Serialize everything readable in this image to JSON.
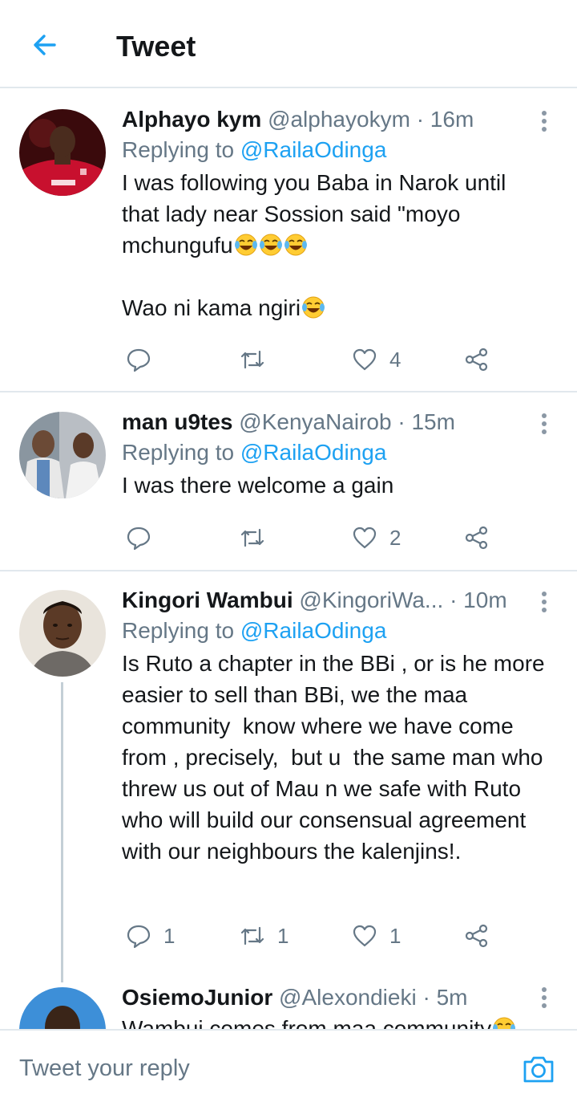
{
  "header": {
    "title": "Tweet",
    "back_icon": "arrow-left-icon"
  },
  "colors": {
    "accent": "#1da1f2",
    "text": "#14171a",
    "secondary": "#657786",
    "divider": "#e1e8ed"
  },
  "tweets": [
    {
      "display_name": "Alphayo kym",
      "handle": "@alphayokym",
      "dot": "·",
      "time": "16m",
      "replying_prefix": "Replying to ",
      "replying_to": "@RailaOdinga",
      "text_line1": "I was following you Baba in Narok until that lady near Sossion said \"moyo mchungufu",
      "text_line2": "Wao ni kama ngiri",
      "emoji_name": "face-with-tears-of-joy",
      "reply_count": "",
      "retweet_count": "",
      "like_count": "4"
    },
    {
      "display_name": "man u9tes",
      "handle": "@KenyaNairob",
      "dot": "·",
      "time": "15m",
      "replying_prefix": "Replying to ",
      "replying_to": "@RailaOdinga",
      "text": "I was there welcome a gain",
      "reply_count": "",
      "retweet_count": "",
      "like_count": "2"
    },
    {
      "display_name": "Kingori Wambui",
      "handle": "@KingoriWa...",
      "dot": "·",
      "time": "10m",
      "replying_prefix": "Replying to ",
      "replying_to": "@RailaOdinga",
      "text": "Is Ruto a chapter in the BBi , or is he more easier to sell than BBi, we the maa community  know where we have come from , precisely,  but u  the same man who threw us out of Mau n we safe with Ruto who will build our consensual agreement  with our neighbours the kalenjins!.",
      "reply_count": "1",
      "retweet_count": "1",
      "like_count": "1"
    },
    {
      "display_name": "OsiemoJunior",
      "handle": "@Alexondieki",
      "dot": "·",
      "time": "5m",
      "text": "Wambui comes from maa community"
    }
  ],
  "reply_bar": {
    "placeholder": "Tweet your reply",
    "camera_icon": "camera-icon"
  }
}
